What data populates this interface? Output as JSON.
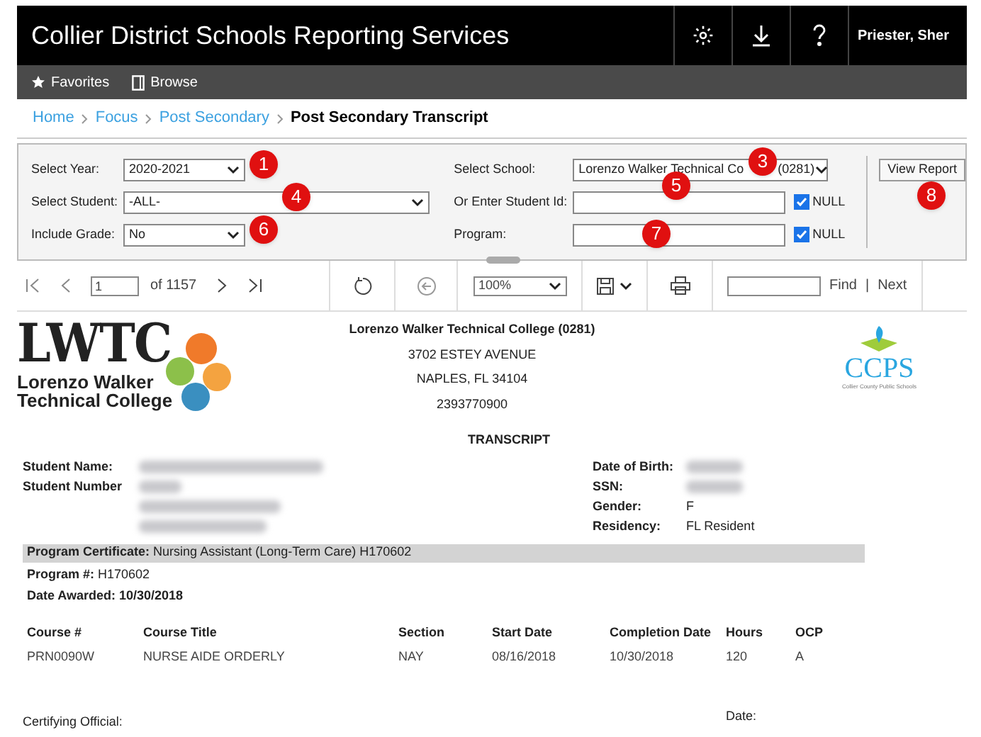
{
  "header": {
    "title": "Collier District Schools Reporting Services",
    "user": "Priester, Sher"
  },
  "nav": [
    "Favorites",
    "Browse"
  ],
  "breadcrumb": [
    {
      "label": "Home",
      "current": false
    },
    {
      "label": "Focus",
      "current": false
    },
    {
      "label": "Post Secondary",
      "current": false
    },
    {
      "label": "Post Secondary Transcript",
      "current": true
    }
  ],
  "parameters": {
    "year": {
      "label": "Select Year:",
      "value": "2020-2021"
    },
    "student": {
      "label": "Select Student:",
      "value": "-ALL-"
    },
    "grade": {
      "label": "Include Grade:",
      "value": "No"
    },
    "school": {
      "label": "Select School:",
      "value": "Lorenzo Walker Technical Co",
      "value_end": "(0281)"
    },
    "student_id": {
      "label": "Or Enter Student Id:",
      "null_label": "NULL",
      "null_checked": true
    },
    "program": {
      "label": "Program:",
      "null_label": "NULL",
      "null_checked": true
    },
    "button": "View Report"
  },
  "callouts": [
    "1",
    "3",
    "4",
    "5",
    "6",
    "7",
    "8"
  ],
  "toolbar": {
    "page": "1",
    "of": "of 1157",
    "zoom": "100%",
    "find": "Find",
    "separator": "|",
    "next": "Next"
  },
  "report": {
    "school_name": "Lorenzo Walker Technical College (0281)",
    "address": [
      "3702 ESTEY AVENUE",
      "NAPLES, FL  34104",
      "2393770900"
    ],
    "logo": {
      "letters": "LWTC",
      "line1": "Lorenzo Walker",
      "line2": "Technical College"
    },
    "right_logo": {
      "letters": "CCPS",
      "caption": "Collier County Public Schools"
    },
    "title": "TRANSCRIPT",
    "left_fields": [
      {
        "label": "Student Name:",
        "blurred": true
      },
      {
        "label": "Student Number",
        "blurred": true
      }
    ],
    "address_blurred": true,
    "right_fields": [
      {
        "label": "Date of Birth:",
        "blurred": true
      },
      {
        "label": "SSN:",
        "blurred": true
      },
      {
        "label": "Gender:",
        "value": "F",
        "blurred": false
      },
      {
        "label": "Residency:",
        "value": "FL Resident",
        "blurred": false
      }
    ],
    "certificate": {
      "label": "Program Certificate:",
      "value": "Nursing Assistant (Long-Term Care) H170602"
    },
    "program_no": {
      "label": "Program #:",
      "value": "H170602"
    },
    "date_awarded": "Date Awarded: 10/30/2018",
    "columns": [
      "Course #",
      "Course Title",
      "Section",
      "Start Date",
      "Completion Date",
      "Hours",
      "OCP"
    ],
    "rows": [
      [
        "PRN0090W",
        "NURSE AIDE  ORDERLY",
        "NAY",
        "08/16/2018",
        "10/30/2018",
        "120",
        "A"
      ]
    ],
    "certifying": "Certifying Official:",
    "date_label": "Date:"
  }
}
